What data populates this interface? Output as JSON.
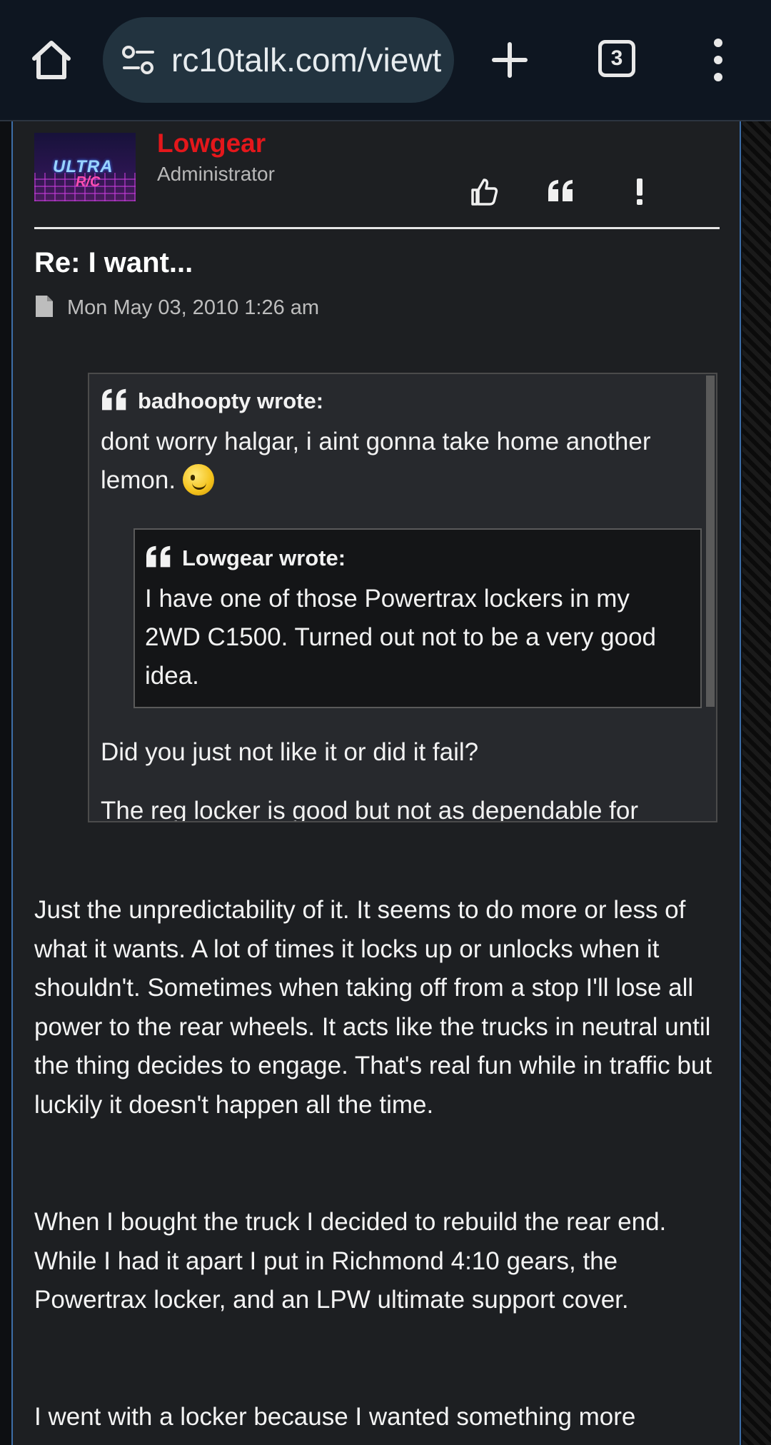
{
  "browser": {
    "url": "rc10talk.com/viewtopic.php",
    "tab_count": "3"
  },
  "post": {
    "author": "Lowgear",
    "role": "Administrator",
    "avatar_text": [
      "ULTRA",
      "R/C"
    ],
    "title": "Re: I want...",
    "date": "Mon May 03, 2010 1:26 am",
    "quote": {
      "header": "badhoopty wrote:",
      "text": "dont worry halgar, i aint gonna take home another lemon.",
      "nested": {
        "header": "Lowgear wrote:",
        "text": "I have one of those Powertrax lockers in my 2WD C1500. Turned out not to be a very good idea."
      },
      "after": "Did you just not like it or did it fail?",
      "cut_line": "The reg locker is good but not as dependable for"
    },
    "paragraphs": [
      "Just the unpredictability of it. It seems to do more or less of what it wants. A lot of times it locks up or unlocks when it shouldn't. Sometimes when taking off from a stop I'll lose all power to the rear wheels. It acts like the trucks in neutral until the thing decides to engage. That's real fun while in traffic but luckily it doesn't happen all the time.",
      "When I bought the truck I decided to rebuild the rear end. While I had it apart I put in Richmond 4:10 gears, the Powertrax locker, and an LPW ultimate support cover.",
      "I went with a locker because I wanted something more"
    ]
  },
  "icons": {
    "home": "home-icon",
    "site_info": "tune-icon",
    "new_tab": "plus-icon",
    "tabs": "tabs-icon",
    "menu": "more-vert-icon",
    "like": "thumbs-up-icon",
    "quote": "quote-icon",
    "report": "exclamation-icon",
    "post_file": "file-icon",
    "smiley": "wink-smiley-icon"
  },
  "colors": {
    "author": "#e4171b",
    "panel_border": "#3d6ea8",
    "toolbar": "#0e1621"
  }
}
